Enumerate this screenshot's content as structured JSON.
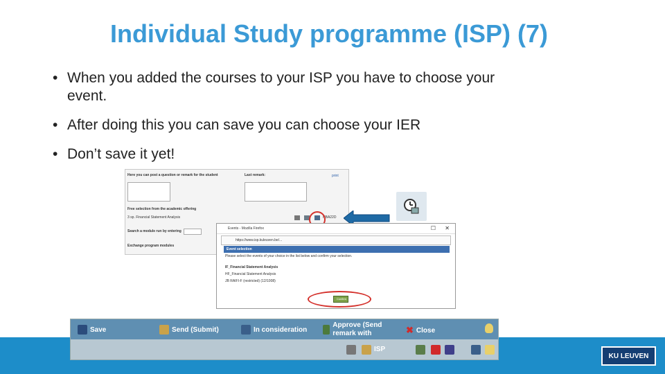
{
  "title": "Individual Study programme (ISP) (7)",
  "bullets": [
    "When you added the courses to your ISP you have to choose your event.",
    "After doing this you can save you can choose your IER",
    "Don’t save it yet!"
  ],
  "screenshot_top": {
    "question_label": "Here you can post a question or remark for the student",
    "last_remark_label": "Last remark:",
    "print_label": "print",
    "free_selection_label": "Free selection from the academic offering",
    "course_row": "3 sp. Financial Statement Analysis",
    "course_code": "HBA22D",
    "search_label": "Search a module run by entering",
    "exchange_label": "Exchange program modules"
  },
  "dialog": {
    "window_title": "Events - Mozilla Firefox",
    "url": "https://www.isp.kuleuven.be/...",
    "section_title": "Event selection",
    "instruction": "Please select the events of your choice in the list below and confirm your selection.",
    "options": [
      "IF_Financial Statement Analysis",
      "HF_Financial Statement Analysis",
      "JB RAIFI-F (restricted) (12/1008)"
    ],
    "confirm_label": "Confirm"
  },
  "toolbar": {
    "save": "Save",
    "send": "Send (Submit)",
    "in_consideration": "In consideration",
    "approve": "Approve (Send remark with",
    "close": "Close",
    "isp": "ISP"
  },
  "footer": {
    "logo": "KU LEUVEN"
  },
  "colors": {
    "title": "#3b9ad6",
    "footer": "#1d8dc9",
    "toolbar": "#5f8fb2",
    "highlight": "#d4302b"
  }
}
